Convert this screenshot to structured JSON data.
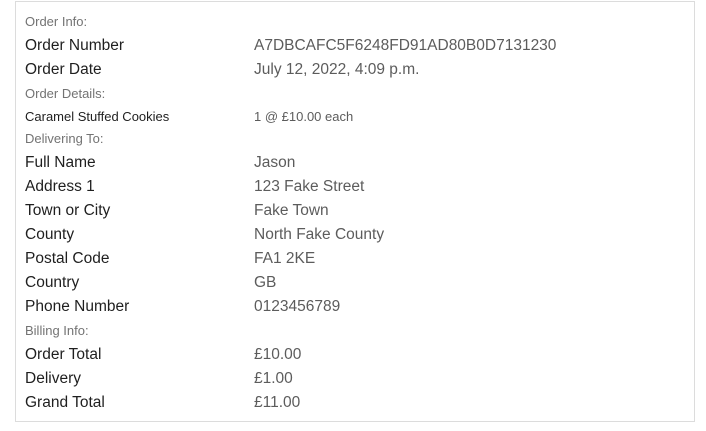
{
  "order_info": {
    "heading": "Order Info:",
    "order_number_label": "Order Number",
    "order_number_value": "A7DBCAFC5F6248FD91AD80B0D7131230",
    "order_date_label": "Order Date",
    "order_date_value": "July 12, 2022, 4:09 p.m."
  },
  "order_details": {
    "heading": "Order Details:",
    "items": [
      {
        "name": "Caramel Stuffed Cookies",
        "quantity_price": "1 @ £10.00 each"
      }
    ]
  },
  "delivering_to": {
    "heading": "Delivering To:",
    "fields": [
      {
        "label": "Full Name",
        "value": "Jason"
      },
      {
        "label": "Address 1",
        "value": "123 Fake Street"
      },
      {
        "label": "Town or City",
        "value": "Fake Town"
      },
      {
        "label": "County",
        "value": "North Fake County"
      },
      {
        "label": "Postal Code",
        "value": "FA1 2KE"
      },
      {
        "label": "Country",
        "value": "GB"
      },
      {
        "label": "Phone Number",
        "value": "0123456789"
      }
    ]
  },
  "billing_info": {
    "heading": "Billing Info:",
    "fields": [
      {
        "label": "Order Total",
        "value": "£10.00"
      },
      {
        "label": "Delivery",
        "value": "£1.00"
      },
      {
        "label": "Grand Total",
        "value": "£11.00"
      }
    ]
  }
}
